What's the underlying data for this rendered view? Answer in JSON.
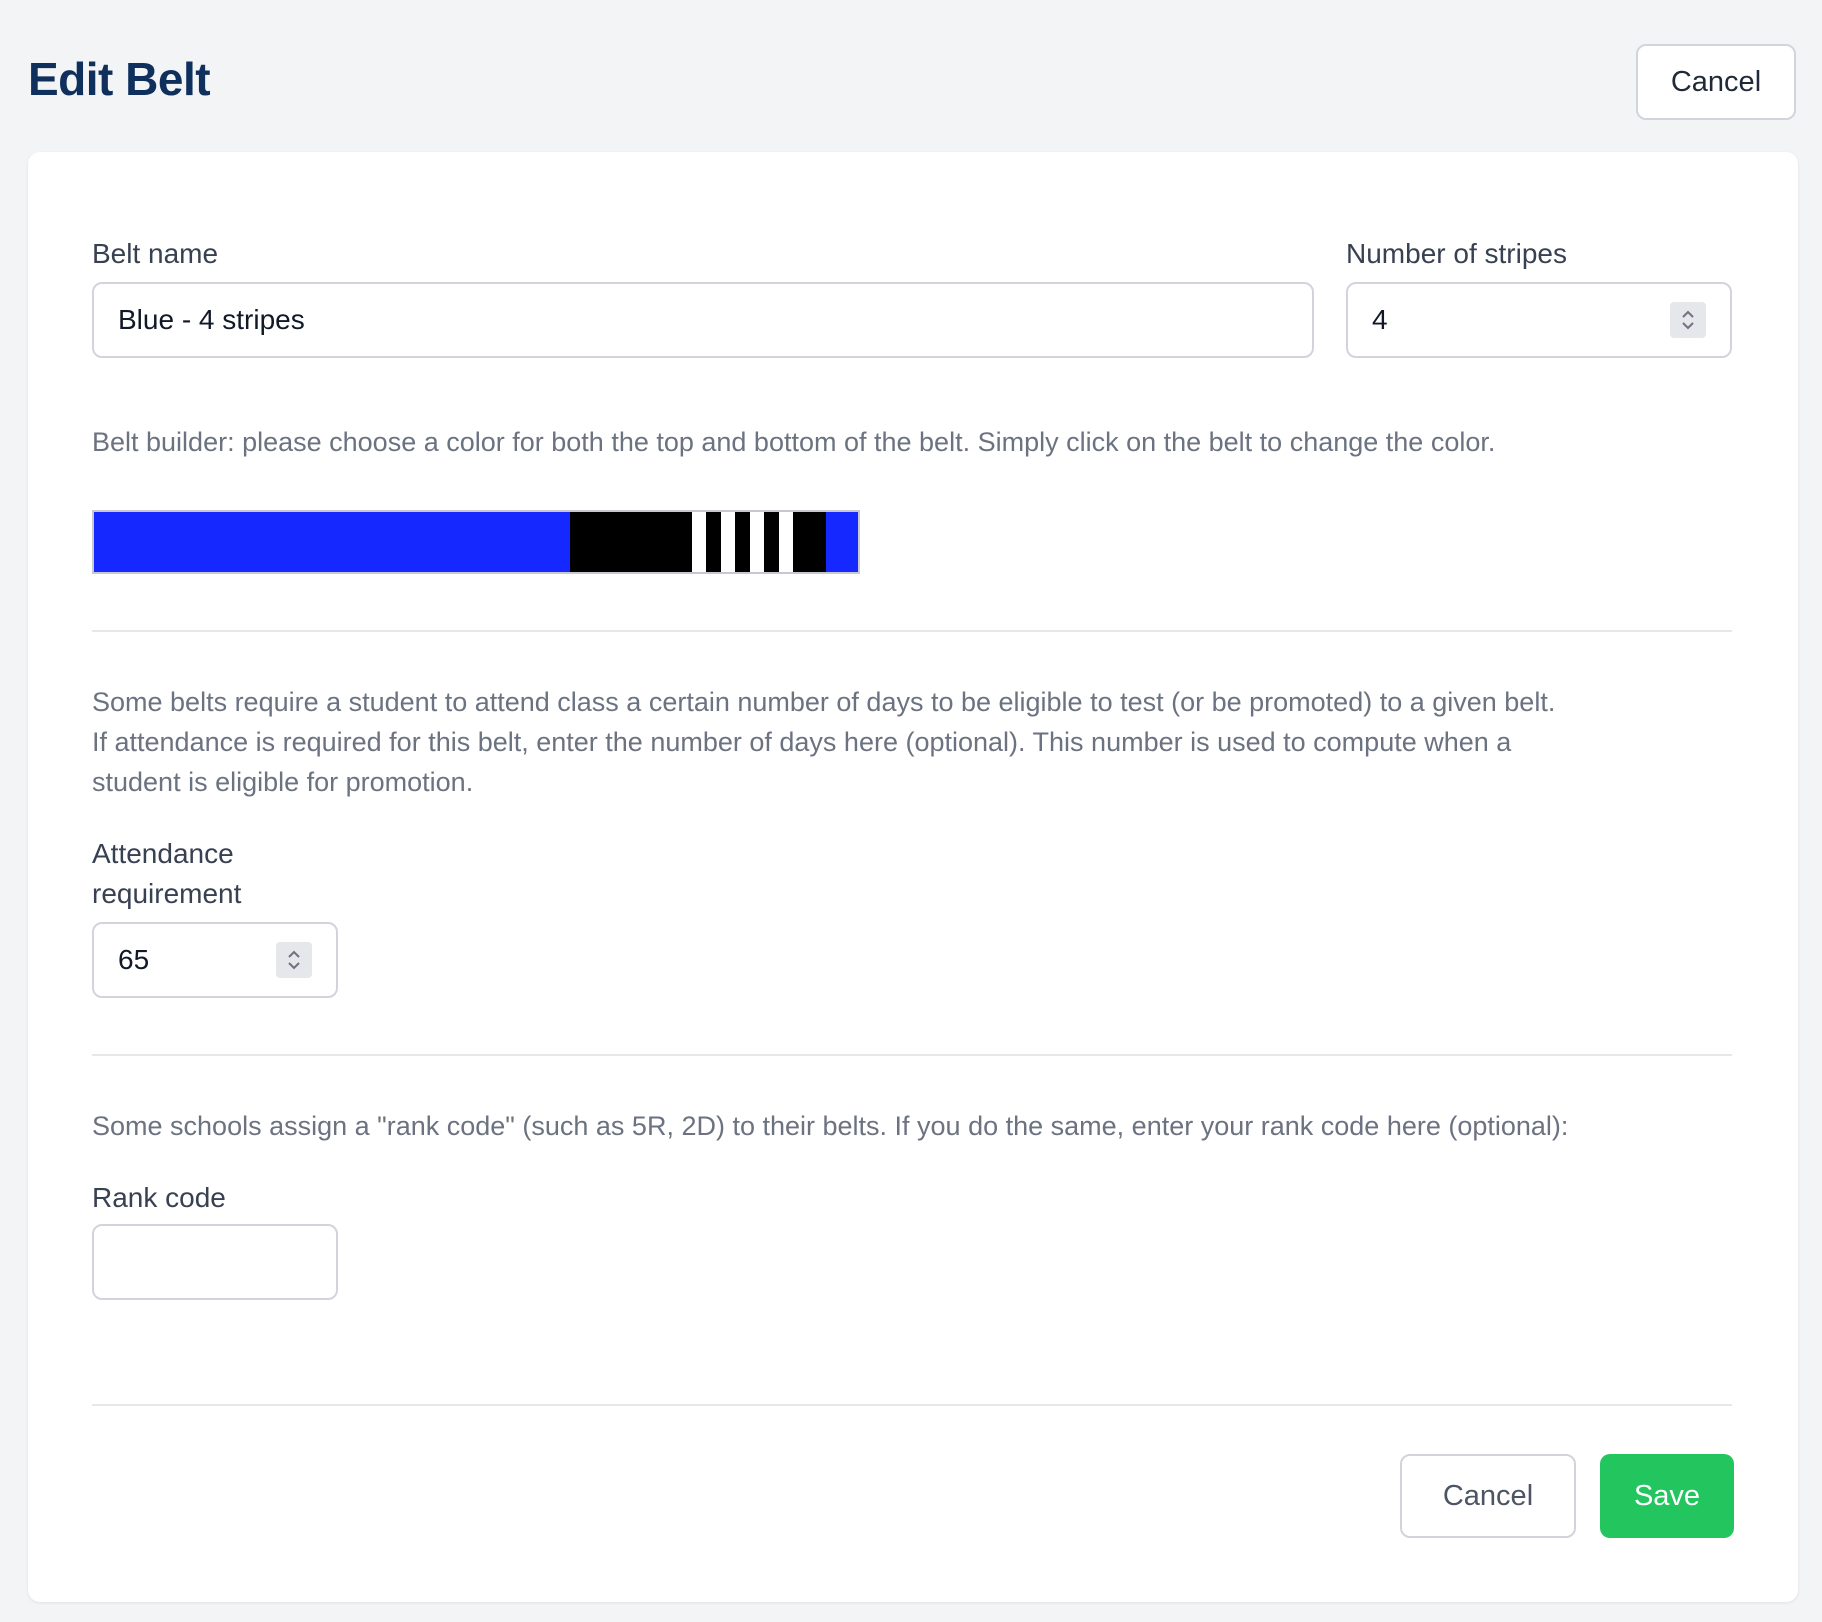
{
  "header": {
    "title": "Edit Belt",
    "cancel_label": "Cancel"
  },
  "form": {
    "belt_name": {
      "label": "Belt name",
      "value": "Blue - 4 stripes"
    },
    "stripes": {
      "label": "Number of stripes",
      "value": "4"
    },
    "belt_builder": {
      "help": "Belt builder: please choose a color for both the top and bottom of the belt. Simply click on the belt to change the color.",
      "belt_color": "#1428ff",
      "tip_color": "#000000",
      "stripe_color": "#ffffff",
      "stripe_count": 4
    },
    "attendance": {
      "help_line1": "Some belts require a student to attend class a certain number of days to be eligible to test (or be promoted) to a given belt.",
      "help_line2": "If attendance is required for this belt, enter the number of days here (optional). This number is used to compute when a",
      "help_line3": "student is eligible for promotion.",
      "label_line1": "Attendance",
      "label_line2": "requirement",
      "value": "65"
    },
    "rank_code": {
      "help": "Some schools assign a \"rank code\" (such as 5R, 2D) to their belts. If you do the same, enter your rank code here (optional):",
      "label": "Rank code",
      "value": ""
    }
  },
  "footer": {
    "cancel_label": "Cancel",
    "save_label": "Save"
  },
  "colors": {
    "accent_save": "#22c55e",
    "title": "#0f2f5c"
  }
}
